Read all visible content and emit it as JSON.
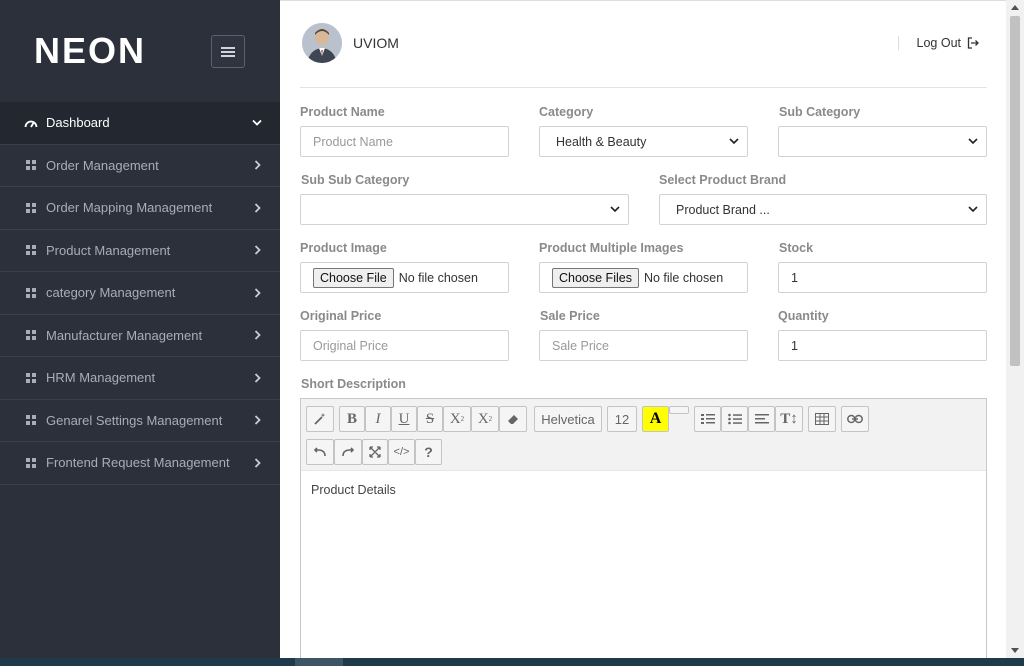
{
  "brand": {
    "logo_text": "NEON"
  },
  "sidebar": {
    "items": [
      {
        "label": "Dashboard",
        "icon": "gauge-icon"
      },
      {
        "label": "Order Management",
        "icon": "grid-icon"
      },
      {
        "label": "Order Mapping Management",
        "icon": "grid-icon"
      },
      {
        "label": "Product Management",
        "icon": "grid-icon"
      },
      {
        "label": "category Management",
        "icon": "grid-icon"
      },
      {
        "label": "Manufacturer Management",
        "icon": "grid-icon"
      },
      {
        "label": "HRM Management",
        "icon": "grid-icon"
      },
      {
        "label": "Genarel Settings Management",
        "icon": "grid-icon"
      },
      {
        "label": "Frontend Request Management",
        "icon": "grid-icon"
      }
    ]
  },
  "header": {
    "username": "UVIOM",
    "logout_label": "Log Out"
  },
  "form": {
    "product_name": {
      "label": "Product Name",
      "placeholder": "Product Name"
    },
    "category": {
      "label": "Category",
      "value": "Health & Beauty"
    },
    "sub_category": {
      "label": "Sub Category",
      "value": ""
    },
    "sub_sub_category": {
      "label": "Sub Sub Category",
      "value": ""
    },
    "brand": {
      "label": "Select Product Brand",
      "value": "Product Brand ..."
    },
    "product_image": {
      "label": "Product Image",
      "button": "Choose File",
      "status": "No file chosen"
    },
    "multiple_images": {
      "label": "Product Multiple Images",
      "button": "Choose Files",
      "status": "No file chosen"
    },
    "stock": {
      "label": "Stock",
      "value": "1"
    },
    "original_price": {
      "label": "Original Price",
      "placeholder": "Original Price"
    },
    "sale_price": {
      "label": "Sale Price",
      "placeholder": "Sale Price"
    },
    "quantity": {
      "label": "Quantity",
      "value": "1"
    },
    "short_description": {
      "label": "Short Description"
    }
  },
  "editor": {
    "font_name": "Helvetica",
    "font_size": "12",
    "content": "Product Details"
  },
  "colors": {
    "sidebar_bg": "#2b303a",
    "sidebar_active": "#232730",
    "highlight": "#ffff00"
  }
}
